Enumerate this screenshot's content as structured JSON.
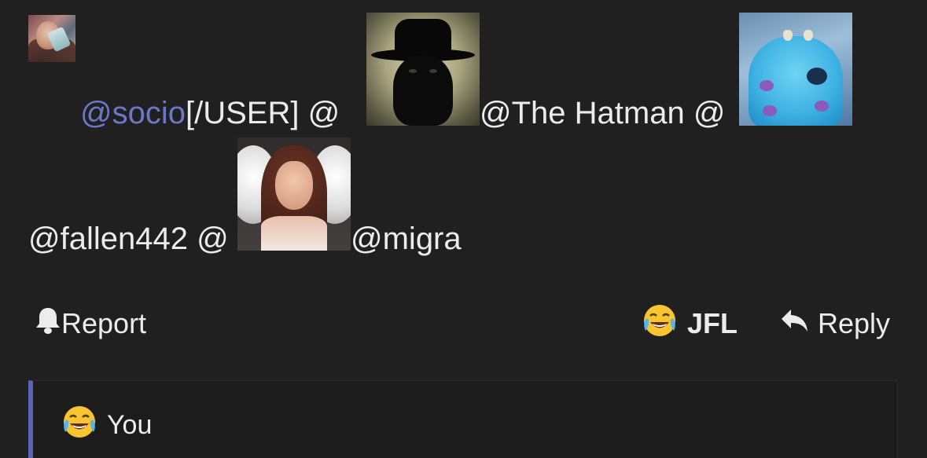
{
  "post": {
    "line1": {
      "mention_user": "@socio",
      "tag_text": "[/USER] @",
      "mention_hatman": "@The Hatman @"
    },
    "line2": {
      "mention_fallen": "@fallen442 @",
      "mention_migra": "@migra"
    }
  },
  "actions": {
    "report_label": "Report",
    "report_icon": "bell-icon",
    "jfl_label": "JFL",
    "jfl_icon": "crying-laughing-emoji-icon",
    "reply_label": "Reply",
    "reply_icon": "reply-arrow-icon"
  },
  "quote": {
    "text": "You",
    "icon": "crying-laughing-emoji-icon"
  },
  "colors": {
    "background": "#202020",
    "mention_link": "#6b77c8",
    "quote_border": "#5d63b5",
    "text": "#ececec"
  }
}
